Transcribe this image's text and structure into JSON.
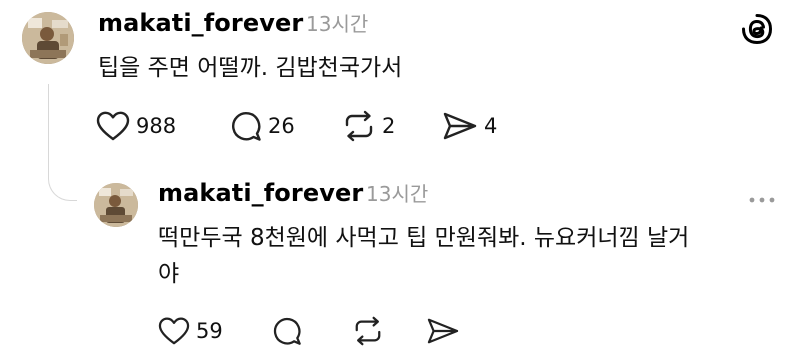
{
  "post": {
    "username": "makati_forever",
    "time": "13시간",
    "text": "팁을 주면 어떨까. 김밥천국가서",
    "likes": "988",
    "comments": "26",
    "reposts": "2",
    "shares": "4"
  },
  "reply": {
    "username": "makati_forever",
    "time": "13시간",
    "text_line1": "떡만두국 8천원에 사먹고 팁 만원줘봐. 뉴요커너낌 날거",
    "text_line2": "야",
    "likes": "59"
  },
  "icons": {
    "app_logo": "threads-logo-icon",
    "more": "more-options-icon",
    "like": "heart-icon",
    "comment": "comment-icon",
    "repost": "repost-icon",
    "share": "share-icon"
  }
}
